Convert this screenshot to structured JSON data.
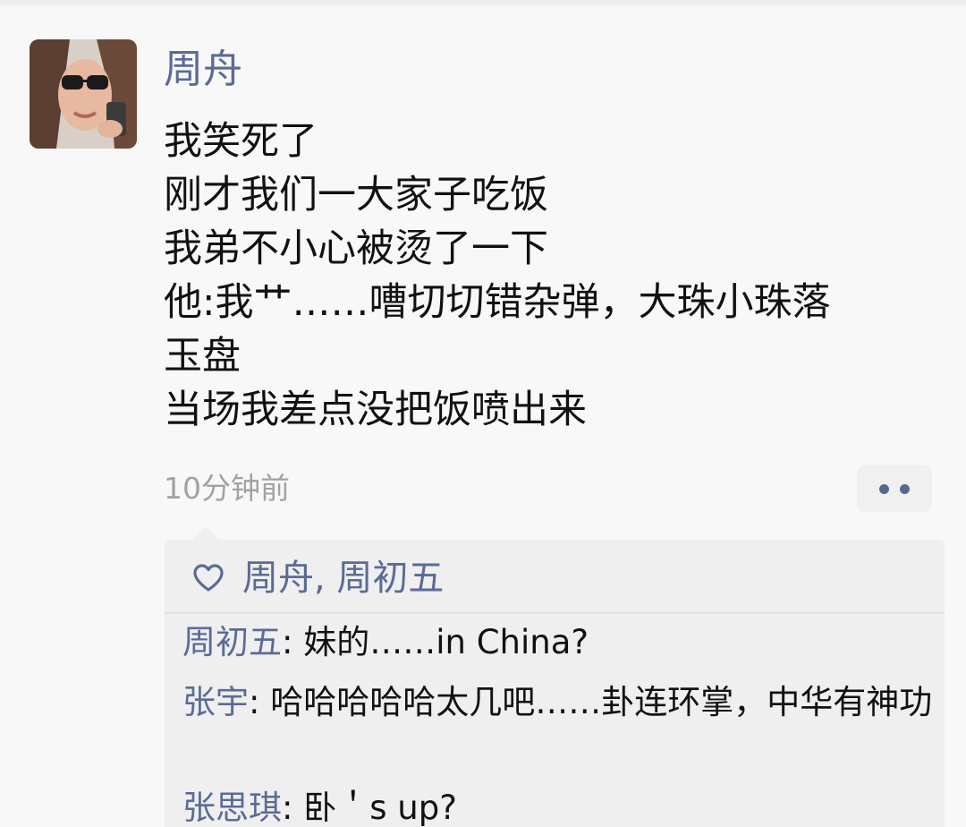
{
  "post": {
    "author": "周舟",
    "lines": [
      "我笑死了",
      "刚才我们一大家子吃饭",
      "我弟不小心被烫了一下",
      "他:我艹……嘈切切错杂弹，大珠小珠落",
      "玉盘",
      "当场我差点没把饭喷出来"
    ],
    "time": "10分钟前",
    "more_icon": "ellipsis-dots"
  },
  "likes": {
    "icon": "heart-outline",
    "names": "周舟, 周初五"
  },
  "comments": [
    {
      "author": "周初五",
      "sep": ": ",
      "text": "妹的……in China?"
    },
    {
      "author": "张宇",
      "sep": ": ",
      "text": "哈哈哈哈哈太几吧……卦连环掌，中华有神功"
    },
    {
      "author": "张思琪",
      "sep": ": ",
      "text": "卧＇s    up?"
    }
  ],
  "colors": {
    "link": "#5b6b95",
    "text": "#111111",
    "muted": "#a2a2a2",
    "box": "#efefef"
  }
}
